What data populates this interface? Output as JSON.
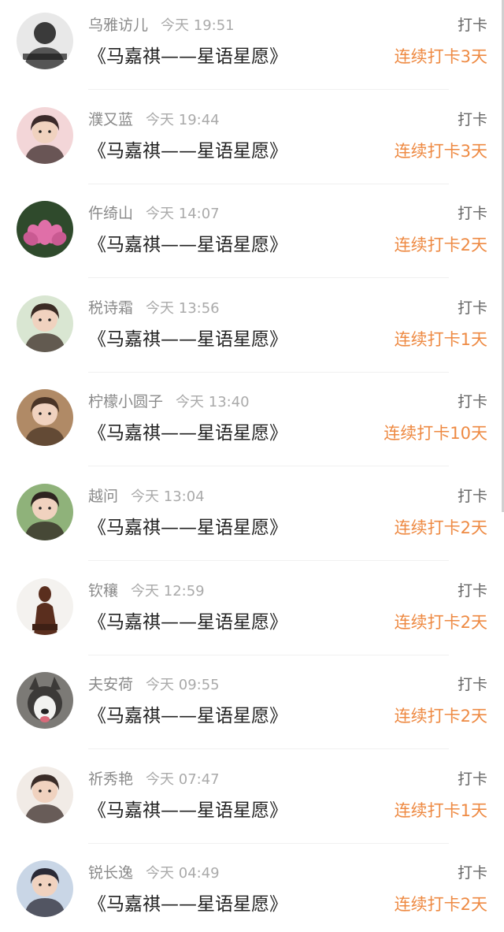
{
  "colors": {
    "streak": "#ee8a43",
    "name": "#8a8a8a",
    "time": "#aaaaaa",
    "title": "#222222",
    "action": "#666666"
  },
  "entries": [
    {
      "name": "乌雅访儿",
      "time": "今天 19:51",
      "title": "《马嘉祺——星语星愿》",
      "action": "打卡",
      "streak": "连续打卡3天",
      "avatar_icon": "user-photo-bw-icon",
      "avatar_colors": [
        "#e8e8e8",
        "#3a3a3a"
      ]
    },
    {
      "name": "濮又蓝",
      "time": "今天 19:44",
      "title": "《马嘉祺——星语星愿》",
      "action": "打卡",
      "streak": "连续打卡3天",
      "avatar_icon": "user-photo-icon",
      "avatar_colors": [
        "#f3d6d8",
        "#3b2a2a"
      ]
    },
    {
      "name": "仵绮山",
      "time": "今天 14:07",
      "title": "《马嘉祺——星语星愿》",
      "action": "打卡",
      "streak": "连续打卡2天",
      "avatar_icon": "lotus-flower-icon",
      "avatar_colors": [
        "#2f4a2c",
        "#e06fa8"
      ]
    },
    {
      "name": "税诗霜",
      "time": "今天 13:56",
      "title": "《马嘉祺——星语星愿》",
      "action": "打卡",
      "streak": "连续打卡1天",
      "avatar_icon": "user-photo-icon",
      "avatar_colors": [
        "#d9e6d2",
        "#3a2b24"
      ]
    },
    {
      "name": "柠檬小圆子",
      "time": "今天 13:40",
      "title": "《马嘉祺——星语星愿》",
      "action": "打卡",
      "streak": "连续打卡10天",
      "avatar_icon": "user-photo-icon",
      "avatar_colors": [
        "#b08a66",
        "#4a3426"
      ]
    },
    {
      "name": "越问",
      "time": "今天 13:04",
      "title": "《马嘉祺——星语星愿》",
      "action": "打卡",
      "streak": "连续打卡2天",
      "avatar_icon": "user-photo-icon",
      "avatar_colors": [
        "#8fb27a",
        "#2e2420"
      ]
    },
    {
      "name": "钦穰",
      "time": "今天 12:59",
      "title": "《马嘉祺——星语星愿》",
      "action": "打卡",
      "streak": "连续打卡2天",
      "avatar_icon": "statue-icon",
      "avatar_colors": [
        "#f4f2ef",
        "#5a2e1e"
      ]
    },
    {
      "name": "夫安荷",
      "time": "今天 09:55",
      "title": "《马嘉祺——星语星愿》",
      "action": "打卡",
      "streak": "连续打卡2天",
      "avatar_icon": "dog-icon",
      "avatar_colors": [
        "#7c7a76",
        "#f2f2f0"
      ]
    },
    {
      "name": "祈秀艳",
      "time": "今天 07:47",
      "title": "《马嘉祺——星语星愿》",
      "action": "打卡",
      "streak": "连续打卡1天",
      "avatar_icon": "user-photo-icon",
      "avatar_colors": [
        "#f1ebe6",
        "#3a2c28"
      ]
    },
    {
      "name": "锐长逸",
      "time": "今天 04:49",
      "title": "《马嘉祺——星语星愿》",
      "action": "打卡",
      "streak": "连续打卡2天",
      "avatar_icon": "user-photo-icon",
      "avatar_colors": [
        "#c9d6e6",
        "#2a2a36"
      ]
    }
  ]
}
